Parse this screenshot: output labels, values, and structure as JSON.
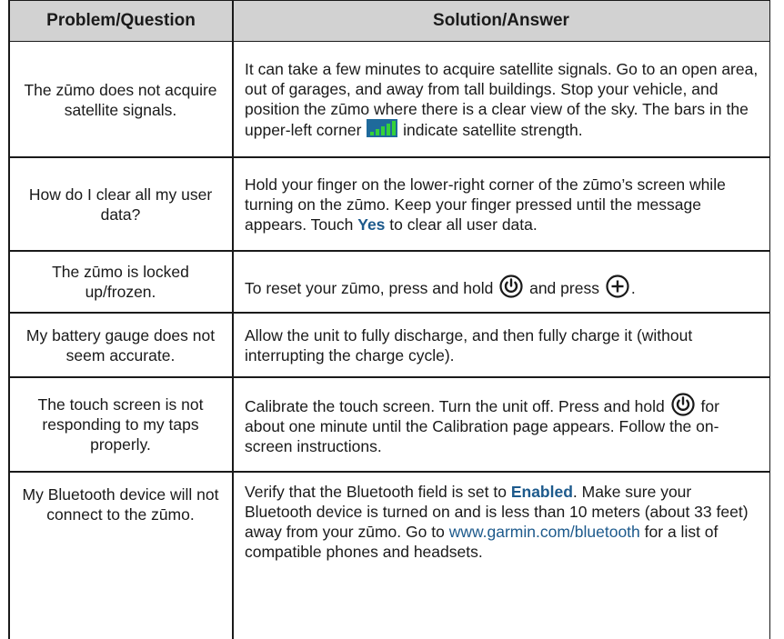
{
  "header": {
    "question": "Problem/Question",
    "answer": "Solution/Answer"
  },
  "rows": [
    {
      "question": "The zūmo does not acquire satellite signals.",
      "answer_pre": "It can take a few minutes to acquire satellite signals. Go to an open area, out of garages, and away from tall buildings. Stop your vehicle, and position the zūmo where there is a clear view of the sky. The bars in the upper-left corner",
      "answer_icon": "satellite-signal-bars-icon",
      "answer_post": "indicate satellite strength."
    },
    {
      "question": "How do I clear all my user data?",
      "answer_pre": "Hold your finger on the lower-right corner of the zūmo’s screen while turning on the zūmo. Keep your finger pressed until the message appears. Touch",
      "answer_bold": "Yes",
      "answer_post": "to clear all user data."
    },
    {
      "question": "The zūmo is locked up/frozen.",
      "answer_pre": "To reset your zūmo, press and hold",
      "answer_icon": "power-button-icon",
      "answer_mid": "and press",
      "answer_icon2": "plus-button-icon",
      "answer_post": "."
    },
    {
      "question": "My battery gauge does not seem accurate.",
      "answer": "Allow the unit to fully discharge, and then fully charge it (without interrupting the charge cycle)."
    },
    {
      "question": "The touch screen is not responding to my taps properly.",
      "answer_pre": "Calibrate the touch screen. Turn the unit off. Press and hold",
      "answer_icon": "power-button-icon",
      "answer_post": "for about one minute until the Calibration page appears. Follow the on-screen instructions."
    },
    {
      "question": "My Bluetooth device will not connect to the zūmo.",
      "answer_pre": "Verify that the Bluetooth field is set to",
      "answer_bold": "Enabled",
      "answer_mid": ". Make sure your Bluetooth device is turned on and is less than 10 meters (about 33 feet) away from your zūmo. Go to",
      "answer_link": "www.garmin.com/bluetooth",
      "answer_post": "for a list of compatible phones and headsets."
    }
  ],
  "colors": {
    "header_bg": "#d2d2d2",
    "accent": "#1d5a8c",
    "signal_bg": "#1e6a9b",
    "signal_bars": "#34d13a"
  }
}
